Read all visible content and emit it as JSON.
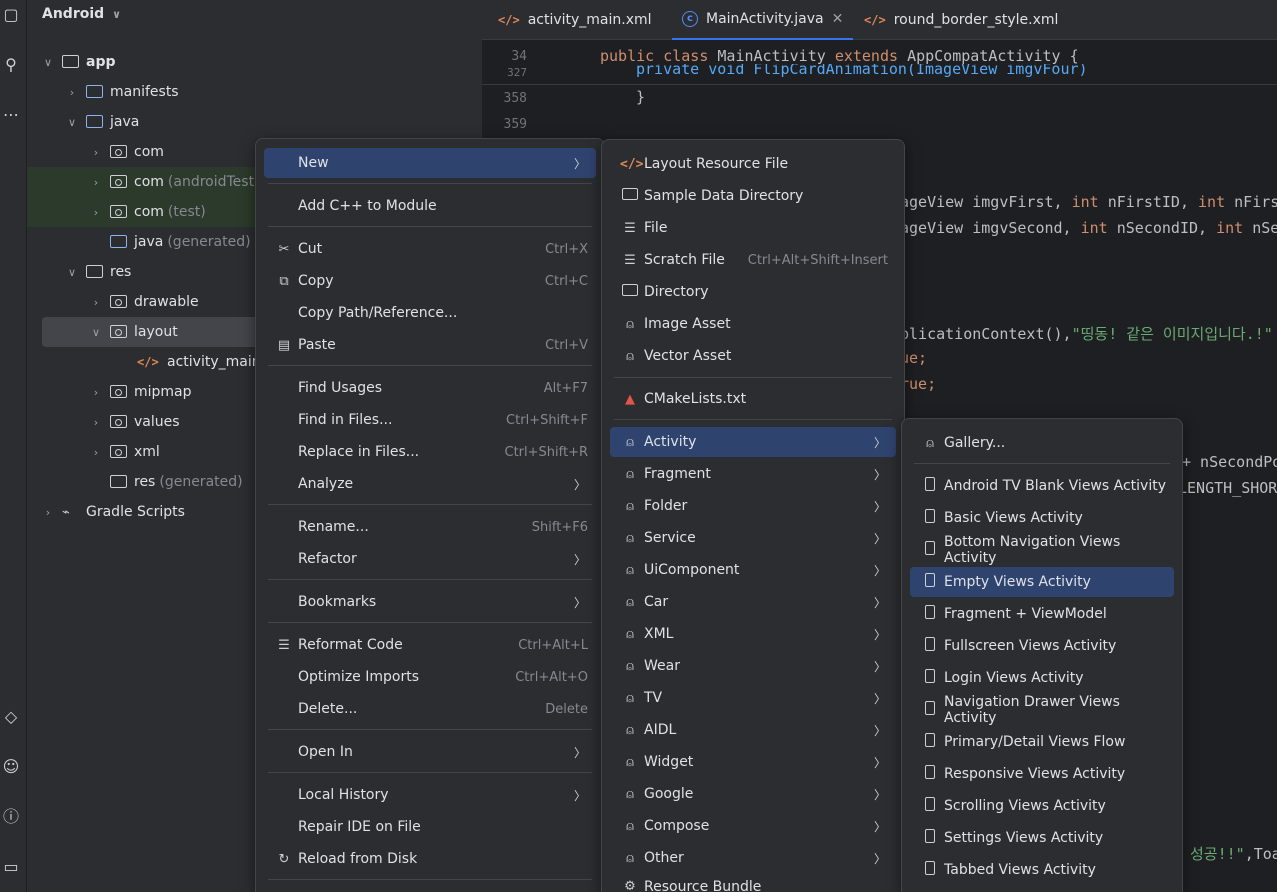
{
  "project": {
    "title": "Android",
    "tree": [
      {
        "label": "app",
        "extra": ""
      },
      {
        "label": "manifests",
        "extra": ""
      },
      {
        "label": "java",
        "extra": ""
      },
      {
        "label": "com",
        "extra": ""
      },
      {
        "label": "com",
        "extra": "(androidTest)"
      },
      {
        "label": "com",
        "extra": "(test)"
      },
      {
        "label": "java",
        "extra": "(generated)"
      },
      {
        "label": "res",
        "extra": ""
      },
      {
        "label": "drawable",
        "extra": ""
      },
      {
        "label": "layout",
        "extra": ""
      },
      {
        "label": "activity_main.xı",
        "extra": ""
      },
      {
        "label": "mipmap",
        "extra": ""
      },
      {
        "label": "values",
        "extra": ""
      },
      {
        "label": "xml",
        "extra": ""
      },
      {
        "label": "res",
        "extra": "(generated)"
      },
      {
        "label": "Gradle Scripts",
        "extra": ""
      }
    ]
  },
  "tabs": [
    {
      "label": "activity_main.xml"
    },
    {
      "label": "MainActivity.java"
    },
    {
      "label": "round_border_style.xml"
    }
  ],
  "editor": {
    "gutter": [
      "34",
      "327",
      "358",
      "359"
    ],
    "line_sticky_kw1": "public class ",
    "line_sticky_name": "MainActivity ",
    "line_sticky_kw2": "extends ",
    "line_sticky_rest": "AppCompatActivity {",
    "line_partial": "private void FlipCardAnimation(ImageView imgvFour)",
    "line_358": "}",
    "frag1": "ageView imgvFirst, ",
    "frag1_kw": "int",
    "frag1_b": " nFirstID, ",
    "frag1_kw2": "int",
    "frag1_c": " nFirs",
    "frag2": "ageView imgvSecond, ",
    "frag2_kw": "int",
    "frag2_b": " nSecondID, ",
    "frag2_kw2": "int",
    "frag2_c": " nSe",
    "frag3": "plicationContext(),",
    "frag3_str": "\"띵동! 같은 이미지입니다.!\"",
    "frag4": "ue;",
    "frag5": "rue;",
    "frag6": "+ nSecondPo",
    "frag7": "LENGTH_SHORT",
    "frag8_str": "성공!!\"",
    "frag8_rest": ",Toa"
  },
  "context_menu": {
    "items": [
      {
        "label": "New",
        "shortcut": "",
        "arrow": true
      },
      {
        "label": "Add C++ to Module",
        "shortcut": ""
      },
      {
        "label": "Cut",
        "shortcut": "Ctrl+X"
      },
      {
        "label": "Copy",
        "shortcut": "Ctrl+C"
      },
      {
        "label": "Copy Path/Reference...",
        "shortcut": ""
      },
      {
        "label": "Paste",
        "shortcut": "Ctrl+V"
      },
      {
        "label": "Find Usages",
        "shortcut": "Alt+F7"
      },
      {
        "label": "Find in Files...",
        "shortcut": "Ctrl+Shift+F"
      },
      {
        "label": "Replace in Files...",
        "shortcut": "Ctrl+Shift+R"
      },
      {
        "label": "Analyze",
        "shortcut": ""
      },
      {
        "label": "Rename...",
        "shortcut": "Shift+F6"
      },
      {
        "label": "Refactor",
        "shortcut": ""
      },
      {
        "label": "Bookmarks",
        "shortcut": ""
      },
      {
        "label": "Reformat Code",
        "shortcut": "Ctrl+Alt+L"
      },
      {
        "label": "Optimize Imports",
        "shortcut": "Ctrl+Alt+O"
      },
      {
        "label": "Delete...",
        "shortcut": "Delete"
      },
      {
        "label": "Open In",
        "shortcut": ""
      },
      {
        "label": "Local History",
        "shortcut": ""
      },
      {
        "label": "Repair IDE on File",
        "shortcut": ""
      },
      {
        "label": "Reload from Disk",
        "shortcut": ""
      }
    ]
  },
  "new_menu": {
    "items": [
      {
        "label": "Layout Resource File",
        "shortcut": ""
      },
      {
        "label": "Sample Data Directory",
        "shortcut": ""
      },
      {
        "label": "File",
        "shortcut": ""
      },
      {
        "label": "Scratch File",
        "shortcut": "Ctrl+Alt+Shift+Insert"
      },
      {
        "label": "Directory",
        "shortcut": ""
      },
      {
        "label": "Image Asset",
        "shortcut": ""
      },
      {
        "label": "Vector Asset",
        "shortcut": ""
      },
      {
        "label": "CMakeLists.txt",
        "shortcut": ""
      },
      {
        "label": "Activity",
        "shortcut": ""
      },
      {
        "label": "Fragment",
        "shortcut": ""
      },
      {
        "label": "Folder",
        "shortcut": ""
      },
      {
        "label": "Service",
        "shortcut": ""
      },
      {
        "label": "UiComponent",
        "shortcut": ""
      },
      {
        "label": "Car",
        "shortcut": ""
      },
      {
        "label": "XML",
        "shortcut": ""
      },
      {
        "label": "Wear",
        "shortcut": ""
      },
      {
        "label": "TV",
        "shortcut": ""
      },
      {
        "label": "AIDL",
        "shortcut": ""
      },
      {
        "label": "Widget",
        "shortcut": ""
      },
      {
        "label": "Google",
        "shortcut": ""
      },
      {
        "label": "Compose",
        "shortcut": ""
      },
      {
        "label": "Other",
        "shortcut": ""
      },
      {
        "label": "Resource Bundle",
        "shortcut": ""
      }
    ]
  },
  "activity_menu": {
    "items": [
      {
        "label": "Gallery..."
      },
      {
        "label": "Android TV Blank Views Activity"
      },
      {
        "label": "Basic Views Activity"
      },
      {
        "label": "Bottom Navigation Views Activity"
      },
      {
        "label": "Empty Views Activity"
      },
      {
        "label": "Fragment + ViewModel"
      },
      {
        "label": "Fullscreen Views Activity"
      },
      {
        "label": "Login Views Activity"
      },
      {
        "label": "Navigation Drawer Views Activity"
      },
      {
        "label": "Primary/Detail Views Flow"
      },
      {
        "label": "Responsive Views Activity"
      },
      {
        "label": "Scrolling Views Activity"
      },
      {
        "label": "Settings Views Activity"
      },
      {
        "label": "Tabbed Views Activity"
      }
    ]
  },
  "colors": {
    "accent": "#3574f0",
    "highlight": "#2e436e",
    "android_green": "#5fb882",
    "keyword": "#cf8e6d",
    "string": "#6aab73"
  }
}
